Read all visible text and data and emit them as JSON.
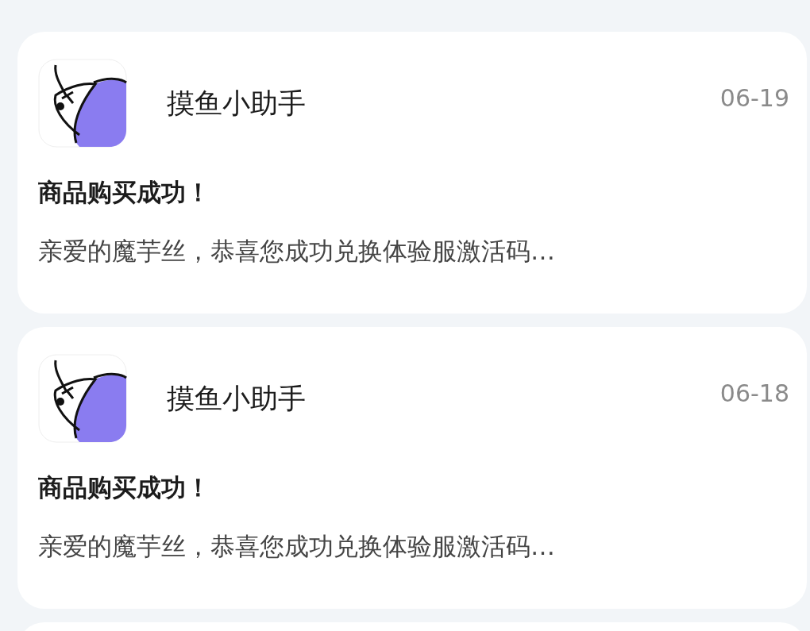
{
  "messages": [
    {
      "sender": "摸鱼小助手",
      "date": "06-19",
      "title": "商品购买成功！",
      "body": "亲爱的魔芋丝，恭喜您成功兑换体验服激活码…"
    },
    {
      "sender": "摸鱼小助手",
      "date": "06-18",
      "title": "商品购买成功！",
      "body": "亲爱的魔芋丝，恭喜您成功兑换体验服激活码…"
    }
  ]
}
